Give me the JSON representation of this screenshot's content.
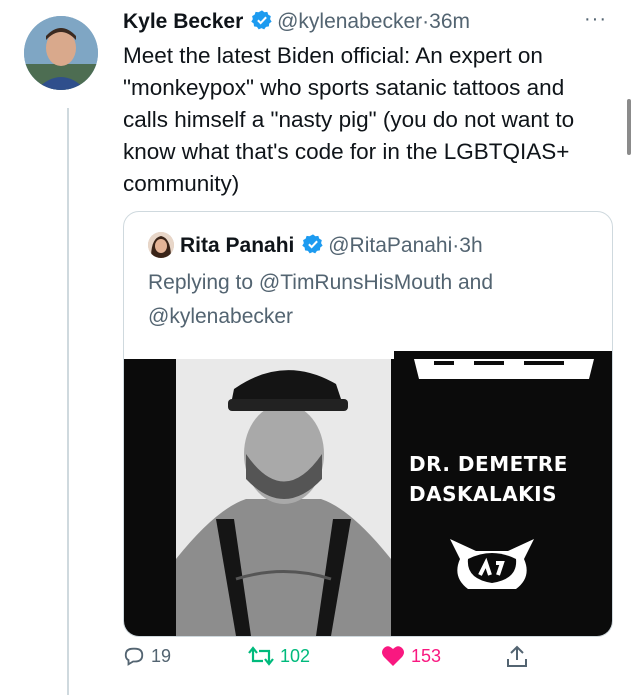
{
  "tweet": {
    "author_name": "Kyle Becker",
    "handle": "@kylenabecker",
    "separator": "·",
    "time": "36m",
    "more": "···",
    "text": "Meet the latest Biden official: An expert on \"monkeypox\" who sports satanic tattoos and calls himself a \"nasty pig\" (you do not want to know what that's code for in the LGBTQIAS+ community)"
  },
  "quote": {
    "author_name": "Rita Panahi",
    "handle": "@RitaPanahi",
    "separator": "·",
    "time": "3h",
    "reply_prefix": "Replying to",
    "reply_to_1": "@TimRunsHisMouth",
    "reply_and": "and",
    "reply_to_2": "@kylenabecker",
    "image_caption_line1": "DR. DEMETRE",
    "image_caption_line2": "DASKALAKIS"
  },
  "actions": {
    "replies": "19",
    "retweets": "102",
    "likes": "153"
  },
  "colors": {
    "verified": "#1d9bf0",
    "retweet": "#00ba7c",
    "like": "#f91880",
    "secondary_text": "#536471"
  },
  "icons": [
    "verified-badge-icon",
    "more-icon",
    "reply-icon",
    "retweet-icon",
    "heart-icon",
    "share-icon"
  ]
}
